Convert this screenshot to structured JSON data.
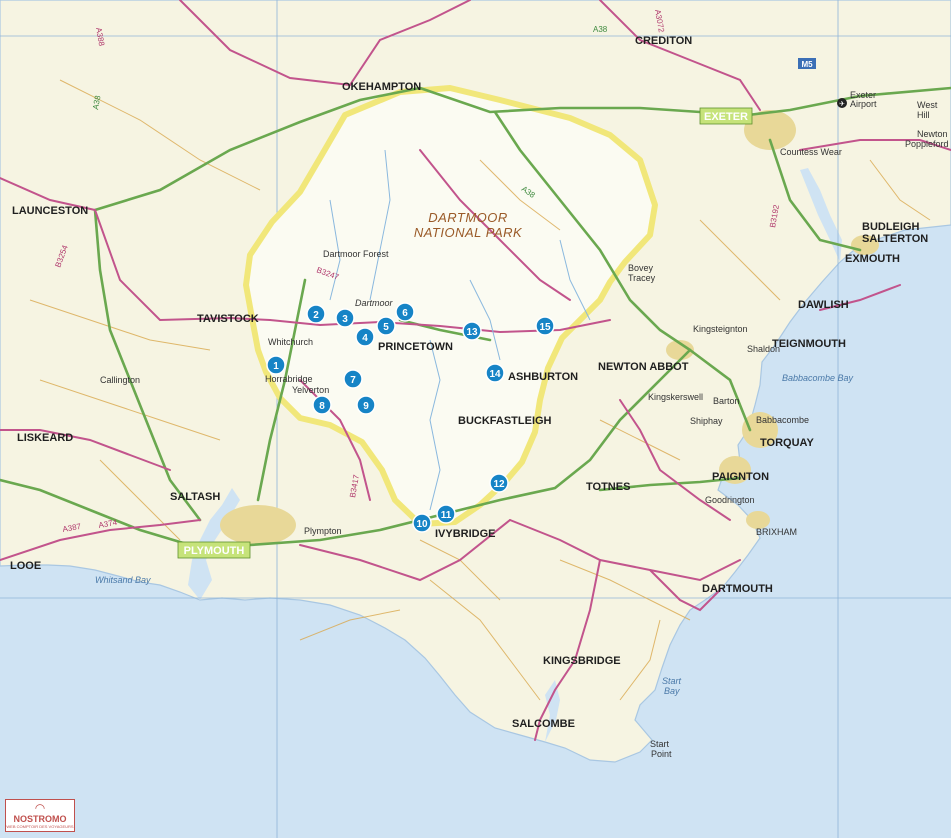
{
  "colors": {
    "sea": "#cfe3f3",
    "land": "#f6f4e2",
    "park": "#fbfbf2",
    "park_border": "#f1e77a",
    "urban": "#e8d898",
    "road_b": "#c2548c",
    "road_a": "#6aa84f",
    "road_minor": "#d9a84d",
    "water": "#8ab8de",
    "marker": "#1684c6",
    "grid": "#8fb4d8",
    "highlight": "#c6e37a"
  },
  "park_label": {
    "line1": "DARTMOOR",
    "line2": "NATIONAL PARK"
  },
  "highlight_labels": {
    "exeter": "EXETER",
    "plymouth": "PLYMOUTH"
  },
  "towns": [
    {
      "key": "okehampton",
      "name": "OKEHAMPTON"
    },
    {
      "key": "crediton",
      "name": "CREDITON"
    },
    {
      "key": "launceston",
      "name": "LAUNCESTON"
    },
    {
      "key": "tavistock",
      "name": "TAVISTOCK"
    },
    {
      "key": "princetown",
      "name": "PRINCETOWN"
    },
    {
      "key": "ashburton",
      "name": "ASHBURTON"
    },
    {
      "key": "buckfastleigh",
      "name": "BUCKFASTLEIGH"
    },
    {
      "key": "newton-abbot",
      "name": "NEWTON ABBOT"
    },
    {
      "key": "teignmouth",
      "name": "TEIGNMOUTH"
    },
    {
      "key": "dawlish",
      "name": "DAWLISH"
    },
    {
      "key": "exmouth",
      "name": "EXMOUTH"
    },
    {
      "key": "budleigh",
      "name": "BUDLEIGH"
    },
    {
      "key": "salterton",
      "name": "SALTERTON"
    },
    {
      "key": "torquay",
      "name": "TORQUAY"
    },
    {
      "key": "paignton",
      "name": "PAIGNTON"
    },
    {
      "key": "totnes",
      "name": "TOTNES"
    },
    {
      "key": "ivybridge",
      "name": "IVYBRIDGE"
    },
    {
      "key": "saltash",
      "name": "SALTASH"
    },
    {
      "key": "liskeard",
      "name": "LISKEARD"
    },
    {
      "key": "looe",
      "name": "LOOE"
    },
    {
      "key": "dartmouth",
      "name": "DARTMOUTH"
    },
    {
      "key": "kingsbridge",
      "name": "KINGSBRIDGE"
    },
    {
      "key": "salcombe",
      "name": "SALCOMBE"
    }
  ],
  "villages": [
    {
      "key": "whitchurch",
      "name": "Whitchurch"
    },
    {
      "key": "horrabridge",
      "name": "Horrabridge"
    },
    {
      "key": "yelverton",
      "name": "Yelverton"
    },
    {
      "key": "callington",
      "name": "Callington"
    },
    {
      "key": "dartmoor-forest",
      "name": "Dartmoor Forest"
    },
    {
      "key": "dartmoor",
      "name": "Dartmoor"
    },
    {
      "key": "bovey",
      "name": "Bovey"
    },
    {
      "key": "tracey",
      "name": "Tracey"
    },
    {
      "key": "kingsteignton",
      "name": "Kingsteignton"
    },
    {
      "key": "shaldon",
      "name": "Shaldon"
    },
    {
      "key": "kingskerswell",
      "name": "Kingskerswell"
    },
    {
      "key": "barton",
      "name": "Barton"
    },
    {
      "key": "shiphay",
      "name": "Shiphay"
    },
    {
      "key": "babbacombe",
      "name": "Babbacombe"
    },
    {
      "key": "goodrington",
      "name": "Goodrington"
    },
    {
      "key": "brixham",
      "name": "BRIXHAM"
    },
    {
      "key": "plympton",
      "name": "Plympton"
    },
    {
      "key": "countess-wear",
      "name": "Countess Wear"
    },
    {
      "key": "exeter-airport-1",
      "name": "Exeter"
    },
    {
      "key": "exeter-airport-2",
      "name": "Airport"
    },
    {
      "key": "west-hill-1",
      "name": "West"
    },
    {
      "key": "west-hill-2",
      "name": "Hill"
    },
    {
      "key": "newton-poppleford-1",
      "name": "Newton"
    },
    {
      "key": "newton-poppleford-2",
      "name": "Poppleford"
    }
  ],
  "sea_labels": [
    {
      "key": "babbacombe-bay",
      "name": "Babbacombe Bay"
    },
    {
      "key": "whitsand-bay",
      "name": "Whitsand Bay"
    },
    {
      "key": "start-bay-1",
      "name": "Start"
    },
    {
      "key": "start-bay-2",
      "name": "Bay"
    },
    {
      "key": "start-point-1",
      "name": "Start"
    },
    {
      "key": "start-point-2",
      "name": "Point"
    }
  ],
  "road_labels": [
    {
      "key": "a388",
      "name": "A388"
    },
    {
      "key": "a38-north",
      "name": "A38"
    },
    {
      "key": "a38-west",
      "name": "A38"
    },
    {
      "key": "a3072",
      "name": "A3072"
    },
    {
      "key": "b3254",
      "name": "B3254"
    },
    {
      "key": "b3247",
      "name": "B3247"
    },
    {
      "key": "a38-dartmoor",
      "name": "A38"
    },
    {
      "key": "b3417",
      "name": "B3417"
    },
    {
      "key": "a387",
      "name": "A387"
    },
    {
      "key": "a374",
      "name": "A374"
    },
    {
      "key": "m5",
      "name": "M5"
    },
    {
      "key": "b3192",
      "name": "B3192"
    }
  ],
  "markers": [
    {
      "id": 1,
      "label": "1"
    },
    {
      "id": 2,
      "label": "2"
    },
    {
      "id": 3,
      "label": "3"
    },
    {
      "id": 4,
      "label": "4"
    },
    {
      "id": 5,
      "label": "5"
    },
    {
      "id": 6,
      "label": "6"
    },
    {
      "id": 7,
      "label": "7"
    },
    {
      "id": 8,
      "label": "8"
    },
    {
      "id": 9,
      "label": "9"
    },
    {
      "id": 10,
      "label": "10"
    },
    {
      "id": 11,
      "label": "11"
    },
    {
      "id": 12,
      "label": "12"
    },
    {
      "id": 13,
      "label": "13"
    },
    {
      "id": 14,
      "label": "14"
    },
    {
      "id": 15,
      "label": "15"
    }
  ],
  "logo": {
    "name": "NOSTROMO",
    "tagline": "WEB COMPTOIR DES VOYAGEURS"
  }
}
